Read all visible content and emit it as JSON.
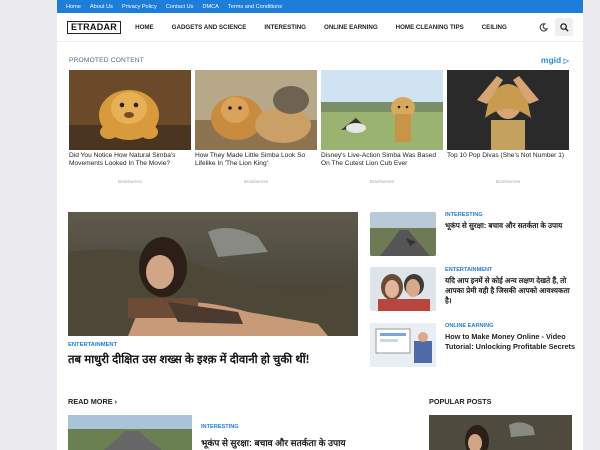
{
  "topbar": {
    "links": [
      "Home",
      "About Us",
      "Privacy Policy",
      "Contact Us",
      "DMCA",
      "Terms and Conditions"
    ]
  },
  "nav": {
    "logo": "ETRADAR",
    "items": [
      "HOME",
      "GADGETS AND SCIENCE",
      "INTERESTING",
      "ONLINE EARNING",
      "HOME CLEANING TIPS",
      "CEILING"
    ],
    "icons": [
      "dark-mode-icon",
      "search-icon"
    ]
  },
  "promo": {
    "title": "PROMOTED CONTENT",
    "brand": "mgid",
    "cards": [
      {
        "caption": "Did You Notice How Natural Simba's Movements Looked In The Movie?",
        "source": "Brainberries"
      },
      {
        "caption": "How They Made Little Simba Look So Lifelike In 'The Lion King'",
        "source": "Brainberries"
      },
      {
        "caption": "Disney's Live-Action Simba Was Based On The Cutest Lion Cub Ever",
        "source": "Brainberries"
      },
      {
        "caption": "Top 10 Pop Divas (She's Not Number 1)",
        "source": "Brainberries"
      }
    ]
  },
  "hero": {
    "category": "ENTERTAINMENT",
    "title": "तब माधुरी दीक्षित उस शख्स के इश्क़ में दीवानी हो चुकी थीं!"
  },
  "side_posts": [
    {
      "category": "INTERESTING",
      "title": "भूकंप से सुरक्षा: बचाव और सतर्कता के उपाय"
    },
    {
      "category": "ENTERTAINMENT",
      "title": "यदि आप इनमें से कोई अन्य लक्षण देखते हैं, तो आपका प्रेमी वही है जिसकी आपको आवश्यकता है।"
    },
    {
      "category": "ONLINE EARNING",
      "title": "How to Make Money Online - Video Tutorial: Unlocking Profitable Secrets"
    }
  ],
  "read_more": {
    "heading": "READ MORE",
    "chevron": "›",
    "category": "INTERESTING",
    "title": "भूकंप से सुरक्षा: बचाव और सतर्कता के उपाय"
  },
  "popular": {
    "heading": "POPULAR POSTS"
  }
}
